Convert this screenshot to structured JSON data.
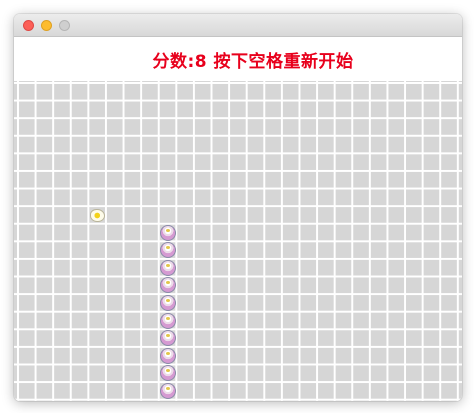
{
  "window": {
    "controls": [
      "close",
      "minimize",
      "zoom"
    ]
  },
  "status": {
    "text": "分数:8 按下空格重新开始"
  },
  "game": {
    "grid": {
      "columns": 25,
      "rows": 18
    },
    "score": 8,
    "food": {
      "col": 4,
      "row": 7
    },
    "snake": [
      {
        "col": 8,
        "row": 8
      },
      {
        "col": 8,
        "row": 9
      },
      {
        "col": 8,
        "row": 10
      },
      {
        "col": 8,
        "row": 11
      },
      {
        "col": 8,
        "row": 12
      },
      {
        "col": 8,
        "row": 13
      },
      {
        "col": 8,
        "row": 14
      },
      {
        "col": 8,
        "row": 15
      },
      {
        "col": 8,
        "row": 16
      },
      {
        "col": 8,
        "row": 17
      }
    ],
    "colors": {
      "board": "#d6d6d6",
      "gridline": "#ffffff",
      "status": "#e8001c",
      "snake": "#d59ad2",
      "food_yolk": "#f3d219"
    }
  }
}
